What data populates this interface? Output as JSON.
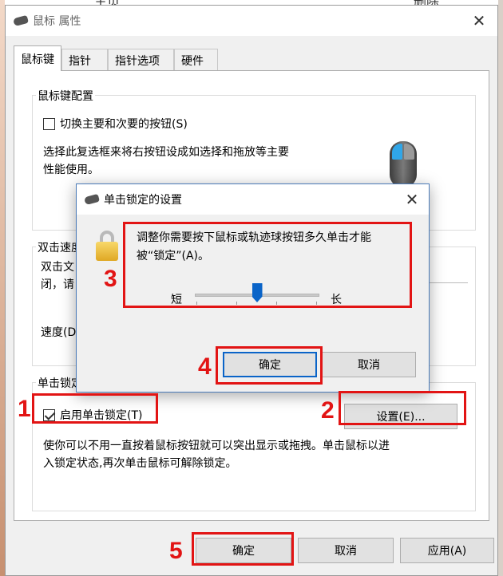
{
  "background": {
    "top_text": "主页",
    "top_text_right": "删除"
  },
  "window": {
    "title": "鼠标 属性",
    "close_glyph": "✕"
  },
  "tabs": [
    {
      "label": "鼠标键",
      "active": true
    },
    {
      "label": "指针",
      "active": false
    },
    {
      "label": "指针选项",
      "active": false
    },
    {
      "label": "硬件",
      "active": false
    }
  ],
  "button_config": {
    "group_label": "鼠标键配置",
    "swap_checkbox_label": "切换主要和次要的按钮(S)",
    "swap_checked": false,
    "description_line1": "选择此复选框来将右按钮设成如选择和拖放等主要",
    "description_line2": "性能使用。"
  },
  "double_click": {
    "group_label": "双击速度",
    "text_line1": "双击文",
    "text_line2": "闭，请",
    "speed_label": "速度(D"
  },
  "clicklock": {
    "group_label": "单击锁定",
    "enable_label": "启用单击锁定(T)",
    "enable_checked": true,
    "settings_button": "设置(E)...",
    "description_line1": "使你可以不用一直按着鼠标按钮就可以突出显示或拖拽。单击鼠标以进",
    "description_line2": "入锁定状态,再次单击鼠标可解除锁定。"
  },
  "footer": {
    "ok": "确定",
    "cancel": "取消",
    "apply": "应用(A)"
  },
  "dialog": {
    "title": "单击锁定的设置",
    "close_glyph": "✕",
    "text_line1": "调整你需要按下鼠标或轨迹球按钮多久单击才能",
    "text_line2": "被“锁定”(A)。",
    "slider_short": "短",
    "slider_long": "长",
    "slider_value": 0.5,
    "ok": "确定",
    "cancel": "取消"
  },
  "annotations": [
    "1",
    "2",
    "3",
    "4",
    "5"
  ],
  "colors": {
    "annotation_red": "#e21414",
    "accent_blue": "#0a64c8"
  }
}
